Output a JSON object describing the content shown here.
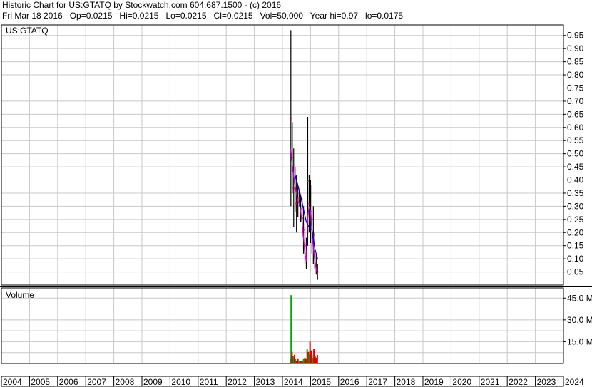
{
  "header": {
    "line1": "Historic Chart for US:GTATQ by Stockwatch.com 604.687.1500 - (c) 2016",
    "line2": "Fri Mar 18 2016   Op=0.0215   Hi=0.0215   Lo=0.0215   Cl=0.0215   Vol=50,000   Year hi=0.97   lo=0.0175"
  },
  "colors": {
    "grid": "#c8c8c8",
    "price_bar": "#000000",
    "ma_fast": "#cc00cc",
    "ma_slow": "#0000cc",
    "close_mark": "#cc0000",
    "volume_up": "#00aa00",
    "volume_down": "#dd0000"
  },
  "chart_data": [
    {
      "type": "line",
      "panel": "price",
      "title": "US:GTATQ",
      "ylim": [
        0,
        0.99
      ],
      "y_ticks": [
        "0.95",
        "0.90",
        "0.85",
        "0.80",
        "0.75",
        "0.70",
        "0.65",
        "0.60",
        "0.55",
        "0.50",
        "0.45",
        "0.40",
        "0.35",
        "0.30",
        "0.25",
        "0.20",
        "0.15",
        "0.10",
        "0.05"
      ],
      "x_labels": [
        "2004",
        "2005",
        "2006",
        "2007",
        "2008",
        "2009",
        "2010",
        "2011",
        "2012",
        "2013",
        "2014",
        "2015",
        "2016",
        "2017",
        "2018",
        "2019",
        "2020",
        "2021",
        "2022",
        "2023",
        "2024"
      ],
      "x_range": [
        2004,
        2024
      ],
      "series": [
        {
          "role": "price_high_low",
          "points": [
            [
              2014.3,
              0.3,
              0.97
            ],
            [
              2014.35,
              0.35,
              0.62
            ],
            [
              2014.4,
              0.22,
              0.52
            ],
            [
              2014.45,
              0.28,
              0.45
            ],
            [
              2014.5,
              0.2,
              0.42
            ],
            [
              2014.55,
              0.26,
              0.38
            ],
            [
              2014.6,
              0.3,
              0.36
            ],
            [
              2014.65,
              0.24,
              0.34
            ],
            [
              2014.7,
              0.18,
              0.33
            ],
            [
              2014.75,
              0.12,
              0.3
            ],
            [
              2014.8,
              0.08,
              0.22
            ],
            [
              2014.85,
              0.06,
              0.18
            ],
            [
              2014.9,
              0.15,
              0.64
            ],
            [
              2014.95,
              0.2,
              0.42
            ],
            [
              2015.0,
              0.16,
              0.4
            ],
            [
              2015.05,
              0.12,
              0.38
            ],
            [
              2015.1,
              0.08,
              0.3
            ],
            [
              2015.15,
              0.06,
              0.2
            ],
            [
              2015.2,
              0.04,
              0.12
            ],
            [
              2015.25,
              0.02,
              0.08
            ]
          ]
        },
        {
          "role": "moving_average_fast",
          "points": [
            [
              2014.3,
              0.52
            ],
            [
              2014.35,
              0.46
            ],
            [
              2014.4,
              0.42
            ],
            [
              2014.45,
              0.38
            ],
            [
              2014.5,
              0.35
            ],
            [
              2014.55,
              0.32
            ],
            [
              2014.6,
              0.31
            ],
            [
              2014.65,
              0.28
            ],
            [
              2014.7,
              0.24
            ],
            [
              2014.75,
              0.18
            ],
            [
              2014.8,
              0.12
            ],
            [
              2014.85,
              0.09
            ],
            [
              2014.9,
              0.26
            ],
            [
              2014.95,
              0.3
            ],
            [
              2015.0,
              0.28
            ],
            [
              2015.05,
              0.2
            ],
            [
              2015.1,
              0.14
            ],
            [
              2015.15,
              0.09
            ],
            [
              2015.2,
              0.06
            ],
            [
              2015.25,
              0.04
            ]
          ]
        },
        {
          "role": "moving_average_slow",
          "points": [
            [
              2014.45,
              0.42
            ],
            [
              2014.55,
              0.38
            ],
            [
              2014.65,
              0.34
            ],
            [
              2014.75,
              0.29
            ],
            [
              2014.85,
              0.24
            ],
            [
              2014.95,
              0.22
            ],
            [
              2015.05,
              0.21
            ],
            [
              2015.15,
              0.14
            ],
            [
              2015.25,
              0.1
            ]
          ]
        }
      ]
    },
    {
      "type": "bar",
      "panel": "volume",
      "title": "Volume",
      "ylim": [
        0,
        52
      ],
      "y_ticks": [
        "45.0 M",
        "30.0 M",
        "15.0 M"
      ],
      "series": [
        {
          "role": "volume",
          "unit": "M",
          "points": [
            [
              2014.28,
              3,
              "down"
            ],
            [
              2014.31,
              47,
              "up"
            ],
            [
              2014.34,
              8,
              "down"
            ],
            [
              2014.37,
              5,
              "down"
            ],
            [
              2014.4,
              4,
              "up"
            ],
            [
              2014.43,
              6,
              "down"
            ],
            [
              2014.46,
              3,
              "up"
            ],
            [
              2014.5,
              2,
              "down"
            ],
            [
              2014.55,
              3,
              "down"
            ],
            [
              2014.6,
              2,
              "up"
            ],
            [
              2014.65,
              2,
              "down"
            ],
            [
              2014.7,
              2,
              "down"
            ],
            [
              2014.75,
              3,
              "up"
            ],
            [
              2014.8,
              4,
              "down"
            ],
            [
              2014.85,
              3,
              "down"
            ],
            [
              2014.88,
              10,
              "up"
            ],
            [
              2014.92,
              8,
              "down"
            ],
            [
              2014.95,
              6,
              "up"
            ],
            [
              2014.98,
              15,
              "down"
            ],
            [
              2015.02,
              9,
              "down"
            ],
            [
              2015.05,
              6,
              "down"
            ],
            [
              2015.08,
              4,
              "up"
            ],
            [
              2015.12,
              10,
              "down"
            ],
            [
              2015.16,
              5,
              "down"
            ],
            [
              2015.2,
              4,
              "down"
            ],
            [
              2015.24,
              6,
              "down"
            ]
          ]
        }
      ]
    }
  ]
}
